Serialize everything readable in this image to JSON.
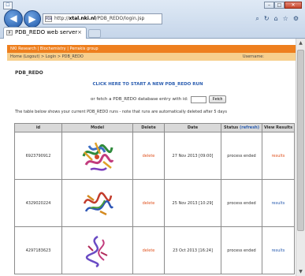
{
  "browser": {
    "url_prefix": "http://",
    "url_host": "xtal.nki.nl",
    "url_path": "/PDB_REDO/login.jsp",
    "tab_title": "PDB_REDO web server",
    "search_icon": "search-icon",
    "home_icon": "home-icon",
    "star_icon": "star-icon",
    "gear_icon": "gear-icon"
  },
  "header": {
    "org_links": [
      "NKI Research",
      "Biochemistry",
      "Perrakis group"
    ],
    "breadcrumb": [
      "Home (Logout)",
      "Login",
      "PDB_REDO"
    ],
    "username_label": "Username:"
  },
  "main": {
    "title": "PDB_REDO",
    "start_run": "CLICK HERE TO START A NEW PDB_REDO RUN",
    "fetch_text": "or fetch a PDB_REDO database entry with id:",
    "fetch_button": "Fetch",
    "note": "The table below shows your current PDB_REDO runs - note that runs are automatically deleted after 5 days"
  },
  "table": {
    "columns": [
      "id",
      "Model",
      "Delete",
      "Date",
      "Status",
      "View Results"
    ],
    "refresh_label": "(refresh)",
    "rows": [
      {
        "id": "6923790912",
        "delete": "delete",
        "date": "27 Nov 2013 [09:00]",
        "status": "process ended",
        "results": "results"
      },
      {
        "id": "4329020224",
        "delete": "delete",
        "date": "25 Nov 2013 [10:29]",
        "status": "process ended",
        "results": "results"
      },
      {
        "id": "4297183623",
        "delete": "delete",
        "date": "23 Oct 2013 [16:24]",
        "status": "process ended",
        "results": "results"
      }
    ]
  },
  "colors": {
    "accent_orange": "#ee7f1e",
    "breadcrumb_bg": "#f7cf8d",
    "link_blue": "#2a5db0",
    "delete_red": "#e0531f"
  }
}
